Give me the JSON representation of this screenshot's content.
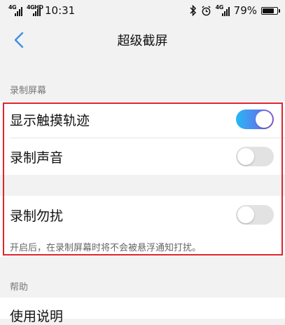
{
  "status_bar": {
    "sim1_tag": "4G",
    "sim2_tag": "4GHD",
    "time": "10:31",
    "network_tag": "4G",
    "battery_percent": "79%",
    "battery_level": 0.79
  },
  "nav": {
    "title": "超级截屏"
  },
  "sections": {
    "record_header": "录制屏幕",
    "help_header": "帮助"
  },
  "settings": {
    "show_touch": {
      "label": "显示触摸轨迹",
      "enabled": true
    },
    "record_audio": {
      "label": "录制声音",
      "enabled": false
    },
    "do_not_disturb": {
      "label": "录制勿扰",
      "enabled": false
    },
    "dnd_hint": "开启后，在录制屏幕时将不会被悬浮通知打扰。"
  },
  "help": {
    "item_label": "使用说明"
  },
  "colors": {
    "toggle_on_start": "#27b8f2",
    "toggle_on_end": "#8a5bd8",
    "highlight_border": "#e0242c"
  }
}
